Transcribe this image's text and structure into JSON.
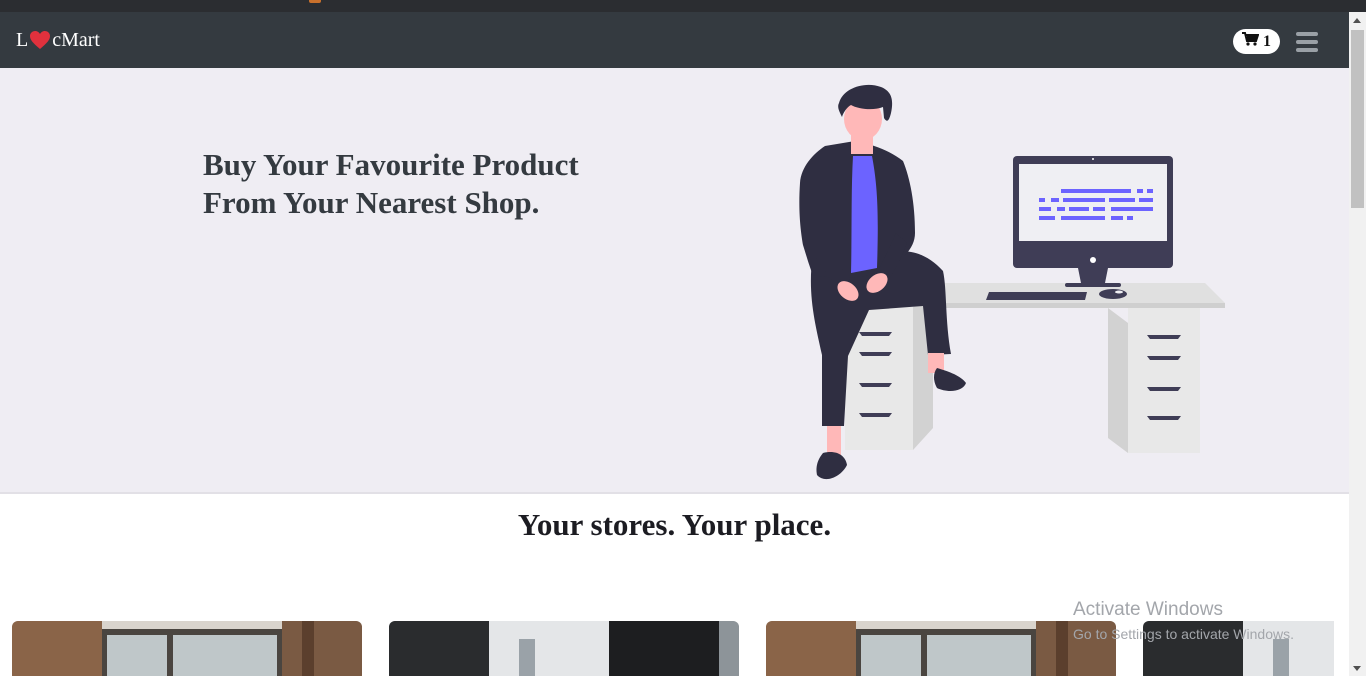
{
  "navbar": {
    "brand_prefix": "L",
    "brand_suffix": "cMart",
    "cart_count": "1"
  },
  "hero": {
    "title_line1": "Buy Your Favourite Product",
    "title_line2": "From Your Nearest Shop."
  },
  "section": {
    "title": "Your stores. Your place."
  },
  "watermark": {
    "line1": "Activate Windows",
    "line2": "Go to Settings to activate Windows."
  },
  "colors": {
    "navbar": "#343a40",
    "hero_bg": "#efedf3",
    "heart": "#e0313d",
    "accent_purple": "#6c63ff"
  },
  "icons": [
    "heart-icon",
    "cart-icon",
    "menu-icon"
  ]
}
